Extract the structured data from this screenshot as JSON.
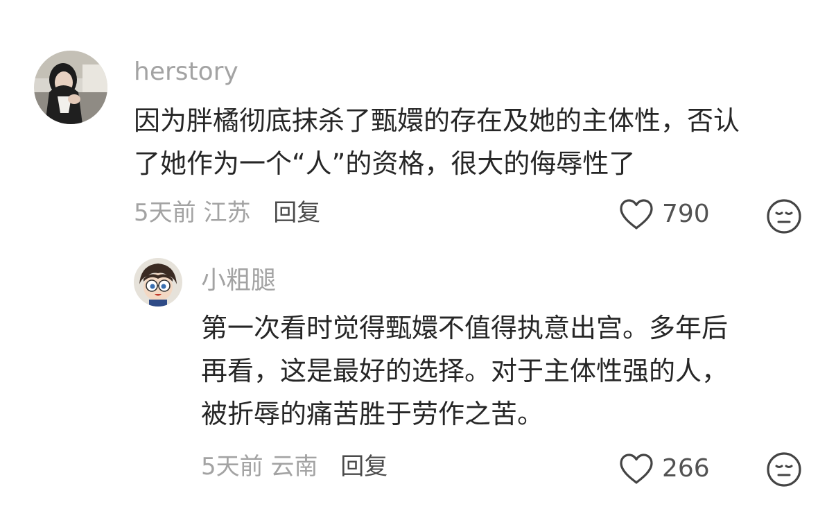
{
  "comments": [
    {
      "username": "herstory",
      "text_lines": [
        "因为胖橘彻底抹杀了甄嬛的存在及她的主体性，否认",
        "了她作为一个“人”的资格，很大的侮辱性了"
      ],
      "time": "5天前",
      "location": "江苏",
      "reply_label": "回复",
      "likes": "790",
      "avatar_icon": "girl-photo-avatar"
    },
    {
      "username": "小粗腿",
      "text_lines": [
        "第一次看时觉得甄嬛不值得执意出宫。多年后",
        "再看，这是最好的选择。对于主体性强的人，",
        "被折辱的痛苦胜于劳作之苦。"
      ],
      "time": "5天前",
      "location": "云南",
      "reply_label": "回复",
      "likes": "266",
      "avatar_icon": "anime-boy-avatar"
    }
  ],
  "colors": {
    "username": "#a3a3a3",
    "text": "#262626",
    "meta": "#a3a3a3",
    "icon": "#444444"
  }
}
